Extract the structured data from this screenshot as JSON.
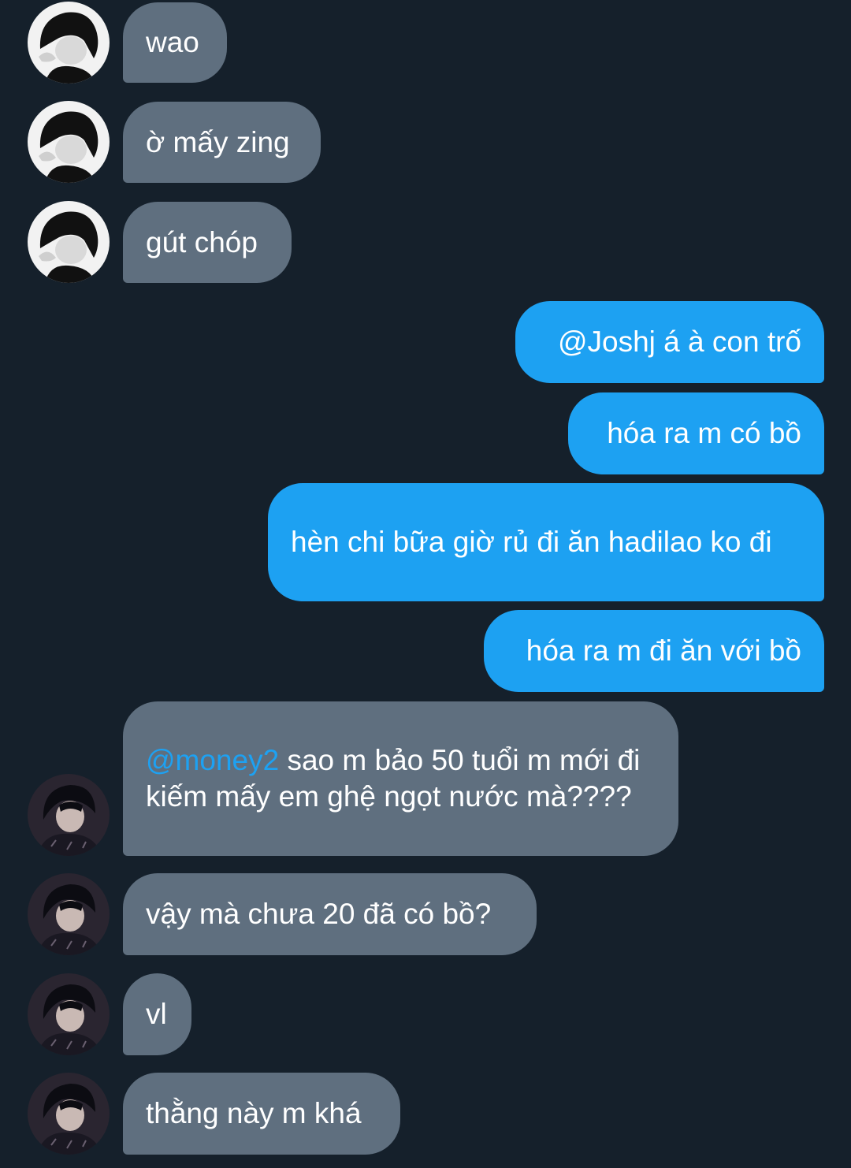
{
  "conversation": {
    "messages": [
      {
        "side": "incoming",
        "avatar": "user-a",
        "text": "wao"
      },
      {
        "side": "incoming",
        "avatar": "user-a",
        "text": "ờ mấy zing"
      },
      {
        "side": "incoming",
        "avatar": "user-a",
        "text": "gút chóp"
      },
      {
        "side": "outgoing",
        "text": "@Joshj á à con trố"
      },
      {
        "side": "outgoing",
        "text": "hóa ra m có bồ"
      },
      {
        "side": "outgoing",
        "text": "hèn chi bữa giờ rủ đi ăn hadilao ko đi"
      },
      {
        "side": "outgoing",
        "text": "hóa ra m đi ăn với bồ"
      },
      {
        "side": "incoming",
        "avatar": "user-b",
        "mention": "@money2",
        "text": " sao m bảo 50 tuổi m mới đi kiếm mấy em ghệ ngọt nước mà????"
      },
      {
        "side": "incoming",
        "avatar": "user-b",
        "text": "vậy mà chưa 20 đã có bồ?"
      },
      {
        "side": "incoming",
        "avatar": "user-b",
        "text": "vl"
      },
      {
        "side": "incoming",
        "avatar": "user-b",
        "text": "thằng này m khá"
      }
    ]
  },
  "colors": {
    "background": "#15202b",
    "incoming_bubble": "#5f6f7f",
    "outgoing_bubble": "#1da1f2",
    "mention": "#1da1f2",
    "text": "#ffffff"
  }
}
